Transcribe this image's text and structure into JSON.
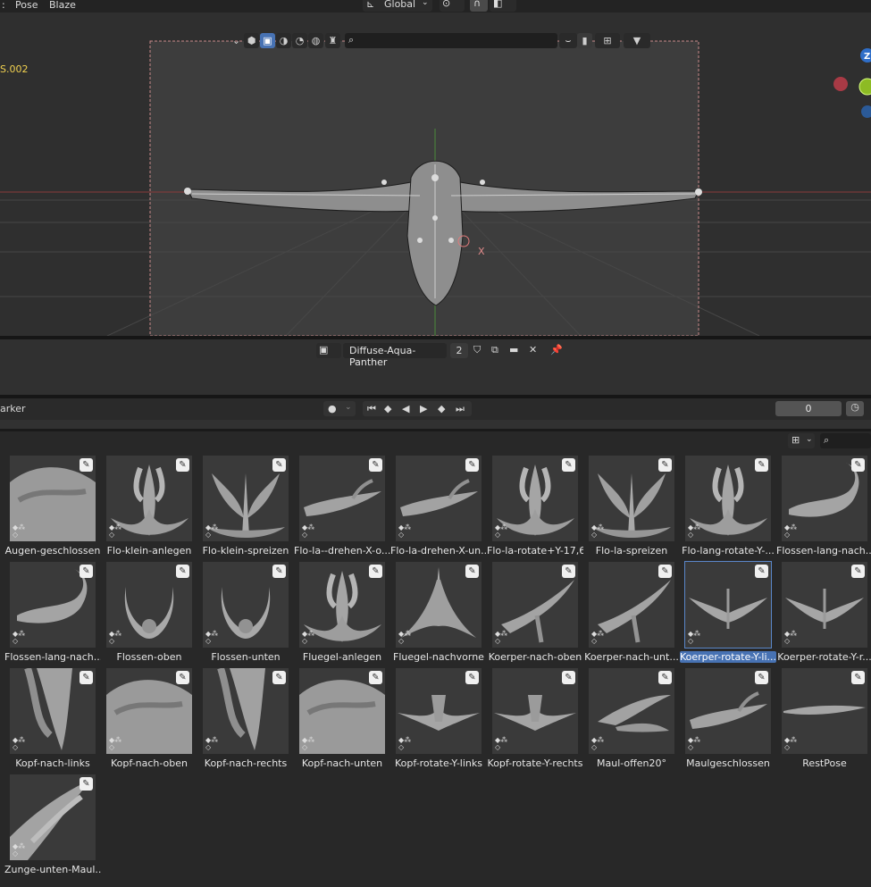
{
  "menu": {
    "items": [
      "Pose",
      "Blaze"
    ]
  },
  "header": {
    "orientation": "Global",
    "search_placeholder": ""
  },
  "viewport": {
    "object_label": "S.002",
    "object_label_color": "#f2d250",
    "gizmo_axis": "Z",
    "axis_label": "X"
  },
  "image_editor": {
    "image_name": "Diffuse-Aqua-Panther",
    "users": "2"
  },
  "timeline": {
    "menu_label": "arker",
    "current_frame": "0"
  },
  "assets": [
    {
      "label": "Augen-geschlossen",
      "shape": "face"
    },
    {
      "label": "Flo-klein-anlegen",
      "shape": "fins-up"
    },
    {
      "label": "Flo-klein-spreizen",
      "shape": "fins-spread"
    },
    {
      "label": "Flo-la--drehen-X-o...",
      "shape": "side-low"
    },
    {
      "label": "Flo-la-drehen-X-un...",
      "shape": "side-low"
    },
    {
      "label": "Flo-la-rotate+Y-17,6",
      "shape": "fins-up"
    },
    {
      "label": "Flo-la-spreizen",
      "shape": "fins-spread"
    },
    {
      "label": "Flo-lang-rotate-Y-...",
      "shape": "fins-up"
    },
    {
      "label": "Flossen-lang-nach...",
      "shape": "curl"
    },
    {
      "label": "Flossen-lang-nach...",
      "shape": "curl"
    },
    {
      "label": "Flossen-oben",
      "shape": "ring"
    },
    {
      "label": "Flossen-unten",
      "shape": "ring"
    },
    {
      "label": "Fluegel-anlegen",
      "shape": "fins-up"
    },
    {
      "label": "Fluegel-nachvorne",
      "shape": "wings"
    },
    {
      "label": "Koerper-nach-oben",
      "shape": "diag"
    },
    {
      "label": "Koerper-nach-unt...",
      "shape": "diag"
    },
    {
      "label": "Koerper-rotate-Y-li...",
      "shape": "glider",
      "selected": true
    },
    {
      "label": "Koerper-rotate-Y-r...",
      "shape": "glider"
    },
    {
      "label": "Kopf-nach-links",
      "shape": "head-down"
    },
    {
      "label": "Kopf-nach-oben",
      "shape": "face"
    },
    {
      "label": "Kopf-nach-rechts",
      "shape": "head-down"
    },
    {
      "label": "Kopf-nach-unten",
      "shape": "face"
    },
    {
      "label": "Kopf-rotate-Y-links",
      "shape": "wide"
    },
    {
      "label": "Kopf-rotate-Y-rechts",
      "shape": "wide"
    },
    {
      "label": "Maul-offen20°",
      "shape": "jaw"
    },
    {
      "label": "Maulgeschlossen",
      "shape": "side-low"
    },
    {
      "label": "RestPose",
      "shape": "flat"
    },
    {
      "label": "Zunge-unten-Maul...",
      "shape": "tongue"
    }
  ]
}
